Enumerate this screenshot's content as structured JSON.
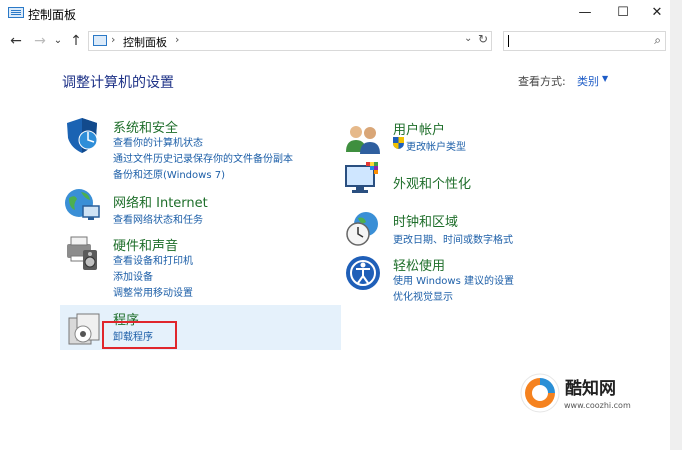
{
  "window": {
    "title": "控制面板",
    "controls": {
      "minimize": "—",
      "maximize": "☐",
      "close": "✕"
    }
  },
  "nav": {
    "back": "←",
    "forward": "→",
    "recent": "⌄",
    "up": "↑",
    "breadcrumb_sep1": "›",
    "breadcrumb": "控制面板",
    "breadcrumb_sep2": "›",
    "dropdown": "⌄",
    "refresh": "↻"
  },
  "search": {
    "value": "",
    "icon": "⌕"
  },
  "main": {
    "heading": "调整计算机的设置",
    "view_by_label": "查看方式:",
    "view_by_value": "类别",
    "view_by_arrow": "▼"
  },
  "categories": {
    "system": {
      "title": "系统和安全",
      "links": [
        "查看你的计算机状态",
        "通过文件历史记录保存你的文件备份副本",
        "备份和还原(Windows 7)"
      ]
    },
    "network": {
      "title": "网络和 Internet",
      "links": [
        "查看网络状态和任务"
      ]
    },
    "hardware": {
      "title": "硬件和声音",
      "links": [
        "查看设备和打印机",
        "添加设备",
        "调整常用移动设置"
      ]
    },
    "programs": {
      "title": "程序",
      "links": [
        "卸载程序"
      ]
    },
    "accounts": {
      "title": "用户帐户",
      "links": [
        "更改帐户类型"
      ]
    },
    "appearance": {
      "title": "外观和个性化",
      "links": []
    },
    "clock": {
      "title": "时钟和区域",
      "links": [
        "更改日期、时间或数字格式"
      ]
    },
    "ease": {
      "title": "轻松使用",
      "links": [
        "使用 Windows 建议的设置",
        "优化视觉显示"
      ]
    }
  },
  "watermark": {
    "name": "酷知网",
    "url": "www.coozhi.com"
  },
  "colors": {
    "heading": "#1e3287",
    "category_title": "#1e6e2a",
    "link": "#1d5fa8",
    "highlight": "#e0262c",
    "hover_bg": "#e5f1fb"
  }
}
